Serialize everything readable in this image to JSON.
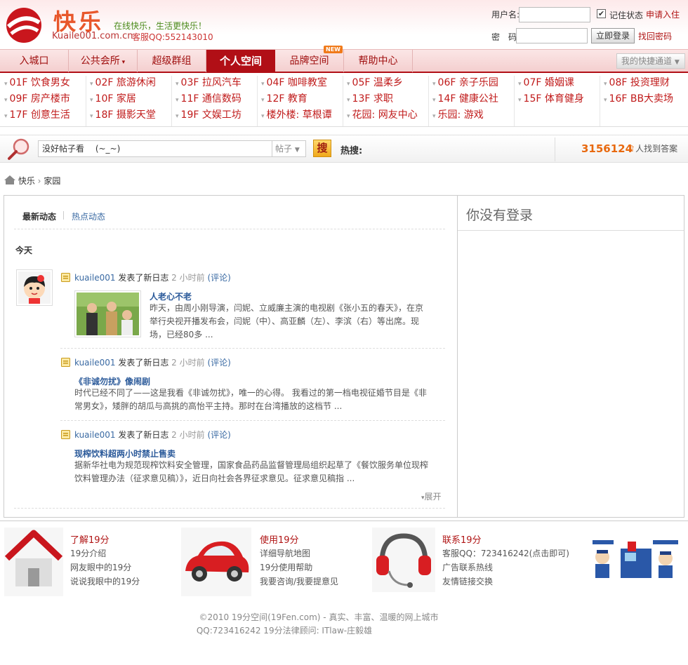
{
  "header": {
    "logo_text": "快乐",
    "logo_domain": "Kuaile001.com.cn",
    "slogan": "在线快乐，生活更快乐！",
    "service_qq": "客服QQ:552143010",
    "username_label": "用户名:",
    "password_label": "密　码:",
    "remember_label": "记住状态",
    "apply_link": "申请入住",
    "login_button": "立即登录",
    "forgot_link": "找回密码"
  },
  "nav": {
    "items": [
      "入城口",
      "公共会所",
      "超级群组",
      "个人空间",
      "品牌空间",
      "帮助中心"
    ],
    "new_badge": "NEW",
    "quick_channel": "我的快捷通道"
  },
  "floors": [
    [
      "01F 饮食男女",
      "02F 旅游休闲",
      "03F 拉风汽车",
      "04F 咖啡教室",
      "05F 温柔乡",
      "06F 亲子乐园",
      "07F 婚姻课",
      "08F 投资理财"
    ],
    [
      "09F 房产楼市",
      "10F 家居",
      "11F 通信数码",
      "12F 教育",
      "13F 求职",
      "14F 健康公社",
      "15F 体育健身",
      "16F BB大卖场"
    ],
    [
      "17F 创意生活",
      "18F 摄影天堂",
      "19F 文娱工坊",
      "楼外楼: 草根谭",
      "花园: 网友中心",
      "乐园: 游戏"
    ]
  ],
  "search": {
    "value": "没好帖子看　 (~_~)",
    "type": "帖子",
    "button": "搜",
    "hot_label": "热搜:",
    "count": "3156124",
    "count_text": "人找到答案"
  },
  "breadcrumb": {
    "home": "快乐",
    "current": "家园"
  },
  "tabs": {
    "latest": "最新动态",
    "hot": "热点动态"
  },
  "today": "今天",
  "feed": [
    {
      "user": "kuaile001",
      "action": "发表了新日志",
      "time": "2 小时前",
      "comment": "(评论)",
      "title": "人老心不老",
      "body": [
        "昨天，由周小刚导演，闫妮、立威廉主演的电视剧《张小五的春天》，在京",
        "举行央视开播发布会，闫妮（中）、高亚麟（左）、李滨（右）等出席。现",
        "场，已经80多 ..."
      ]
    },
    {
      "user": "kuaile001",
      "action": "发表了新日志",
      "time": "2 小时前",
      "comment": "(评论)",
      "title": "《非诚勿扰》像闹剧",
      "body": [
        "时代已经不同了——这是我看《非诚勿扰》，唯一的心得。 我看过的第一档电视征婚节目是《非",
        "常男女》，矮胖的胡瓜与高挑的高怡平主持。那时在台湾播放的这档节 ..."
      ]
    },
    {
      "user": "kuaile001",
      "action": "发表了新日志",
      "time": "2 小时前",
      "comment": "(评论)",
      "title": "现榨饮料超两小时禁止售卖",
      "body": [
        "据新华社电为规范现榨饮料安全管理，国家食品药品监督管理局组织起草了《餐饮服务单位现榨",
        "饮料管理办法（征求意见稿）》，近日向社会各界征求意见。征求意见稿指 ..."
      ]
    }
  ],
  "expand": "展开",
  "right": {
    "title": "你没有登录"
  },
  "footer": {
    "sections": [
      {
        "title": "了解19分",
        "items": [
          "19分介绍",
          "网友眼中的19分",
          "说说我眼中的19分"
        ]
      },
      {
        "title": "使用19分",
        "items": [
          "详细导航地图",
          "19分使用帮助",
          "我要咨询/我要提意见"
        ]
      },
      {
        "title": "联系19分",
        "items": [
          "客服QQ：723416242(点击即可)",
          "广告联系热线",
          "友情链接交换"
        ]
      }
    ],
    "copyright": "©2010 19分空间(19Fen.com) - 真实、丰富、温暖的网上城市",
    "legal": "QQ:723416242 19分法律顾问: ITlaw-庄毅雄"
  }
}
